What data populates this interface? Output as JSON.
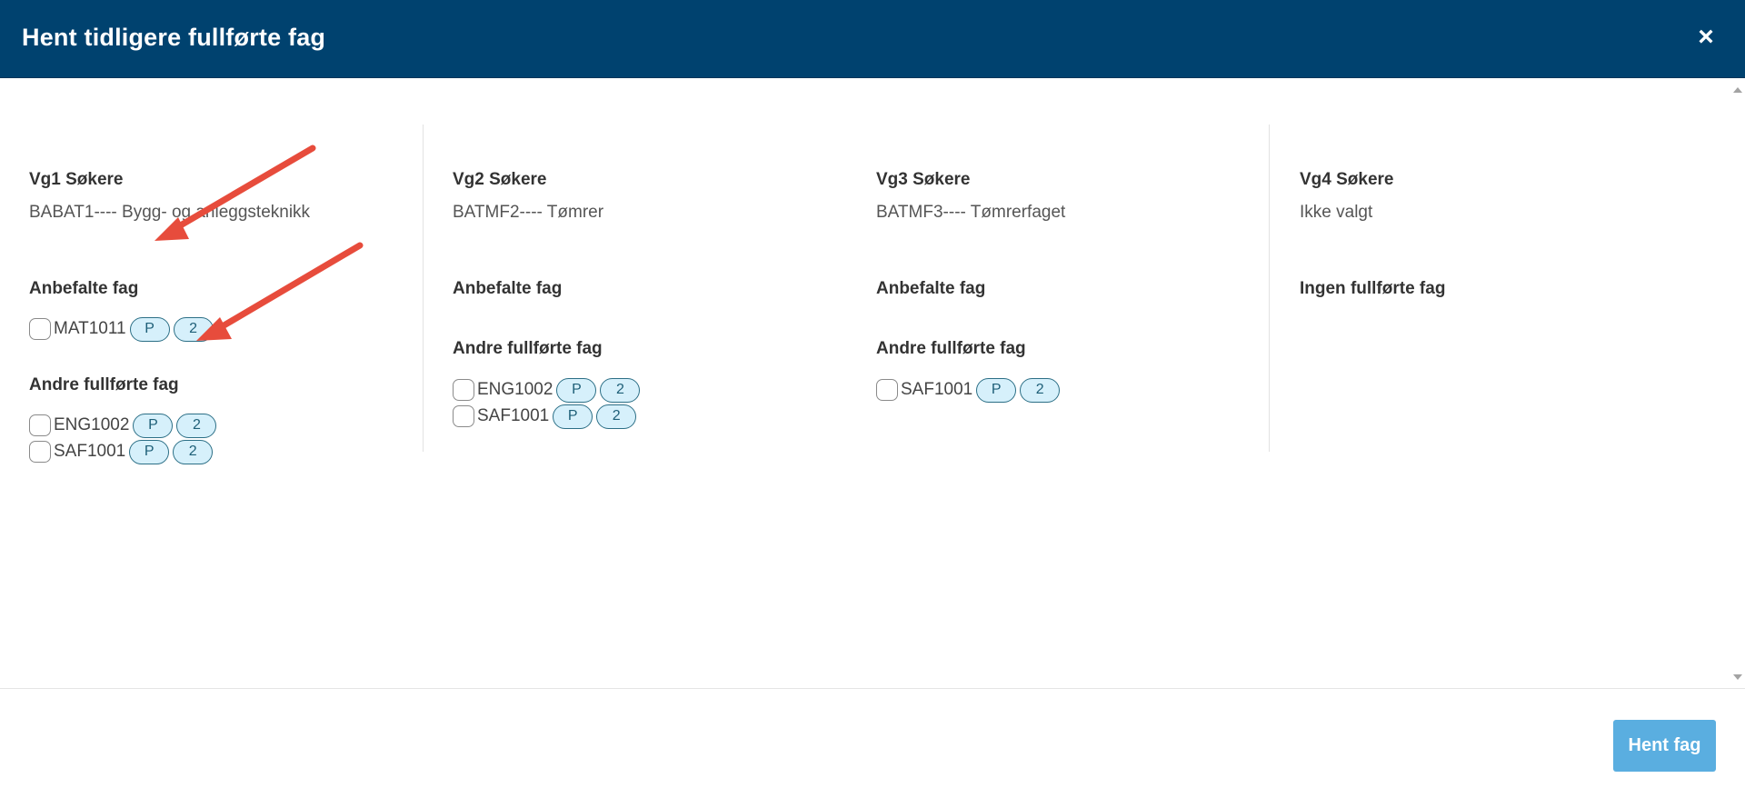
{
  "modal": {
    "title": "Hent tidligere fullførte fag",
    "close_label": "×"
  },
  "columns": [
    {
      "title": "Vg1 Søkere",
      "program": "BABAT1---- Bygg- og anleggsteknikk",
      "recommended_heading": "Anbefalte fag",
      "recommended": [
        {
          "code": "MAT1011",
          "badges": [
            "P",
            "2"
          ]
        }
      ],
      "other_heading": "Andre fullførte fag",
      "other": [
        {
          "code": "ENG1002",
          "badges": [
            "P",
            "2"
          ]
        },
        {
          "code": "SAF1001",
          "badges": [
            "P",
            "2"
          ]
        }
      ]
    },
    {
      "title": "Vg2 Søkere",
      "program": "BATMF2---- Tømrer",
      "recommended_heading": "Anbefalte fag",
      "other_heading": "Andre fullførte fag",
      "other": [
        {
          "code": "ENG1002",
          "badges": [
            "P",
            "2"
          ]
        },
        {
          "code": "SAF1001",
          "badges": [
            "P",
            "2"
          ]
        }
      ]
    },
    {
      "title": "Vg3 Søkere",
      "program": "BATMF3---- Tømrerfaget",
      "recommended_heading": "Anbefalte fag",
      "other_heading": "Andre fullførte fag",
      "other": [
        {
          "code": "SAF1001",
          "badges": [
            "P",
            "2"
          ]
        }
      ]
    },
    {
      "title": "Vg4 Søkere",
      "program": "Ikke valgt",
      "empty_heading": "Ingen fullførte fag"
    }
  ],
  "footer": {
    "submit_label": "Hent fag",
    "submit_color": "#5aaee0"
  },
  "colors": {
    "header_bg": "#00426f",
    "badge_bg": "#d6f0fb",
    "annotation_arrow": "#e74c3c"
  }
}
